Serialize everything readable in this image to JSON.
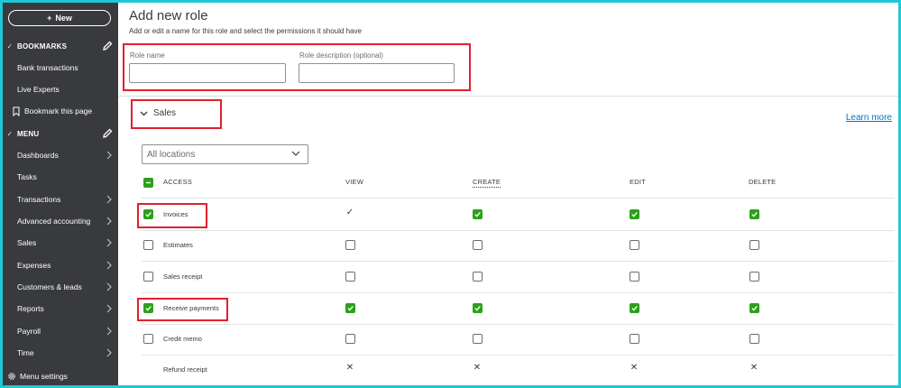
{
  "sidebar": {
    "new_label": "New",
    "bookmarks_label": "BOOKMARKS",
    "bookmarks": [
      "Bank transactions",
      "Live Experts"
    ],
    "bookmark_page_label": "Bookmark this page",
    "menu_label": "MENU",
    "menu_items": [
      "Dashboards",
      "Tasks",
      "Transactions",
      "Advanced accounting",
      "Sales",
      "Expenses",
      "Customers & leads",
      "Reports",
      "Payroll",
      "Time"
    ],
    "menu_settings_label": "Menu settings"
  },
  "main": {
    "title": "Add new role",
    "subtitle": "Add or edit a name for this role and select the permissions it should have",
    "role_name_label": "Role name",
    "role_name_value": "",
    "role_description_label": "Role description (optional)",
    "role_description_value": "",
    "section_label": "Sales",
    "learn_more": "Learn more",
    "locations_placeholder": "All locations",
    "columns": {
      "access": "ACCESS",
      "view": "VIEW",
      "create": "CREATE",
      "edit": "EDIT",
      "delete": "DELETE"
    },
    "rows": [
      {
        "label": "Invoices",
        "access": true,
        "view": "check",
        "create": true,
        "edit": true,
        "delete": true
      },
      {
        "label": "Estimates",
        "access": false,
        "view": "box",
        "create": false,
        "edit": false,
        "delete": false
      },
      {
        "label": "Sales receipt",
        "access": false,
        "view": "box",
        "create": false,
        "edit": false,
        "delete": false
      },
      {
        "label": "Receive payments",
        "access": true,
        "view": "on",
        "create": true,
        "edit": true,
        "delete": true
      },
      {
        "label": "Credit memo",
        "access": false,
        "view": "box",
        "create": false,
        "edit": false,
        "delete": false
      },
      {
        "label": "Refund receipt",
        "access": null,
        "view": "x",
        "create": "x",
        "edit": "x",
        "delete": "x"
      }
    ]
  },
  "colors": {
    "sidebar_bg": "#393a3d",
    "accent_green": "#2ca01c",
    "highlight_red": "#e0202f",
    "link_blue": "#0077c5",
    "frame_cyan": "#1ec8d8"
  }
}
